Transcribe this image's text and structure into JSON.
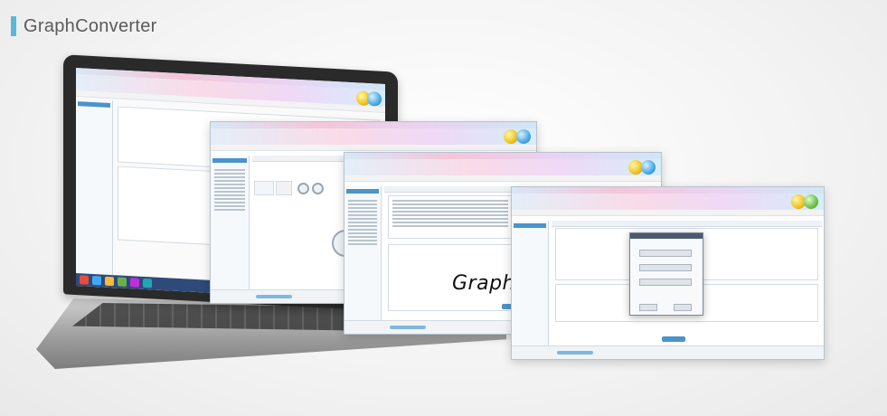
{
  "header": {
    "title": "GraphConverter",
    "accent_color": "#5bb7d6"
  },
  "logo": {
    "text": "GraphLight"
  },
  "colors": {
    "ribbon_pink": "#f3c6d8",
    "sidebar_blue": "#4c93c9",
    "orb_yellow": "#f0c21e",
    "orb_green": "#6fc24a",
    "orb_blue": "#49a9e6"
  },
  "icons": [
    "logo-orbs-icon",
    "back-arrow-icon"
  ]
}
